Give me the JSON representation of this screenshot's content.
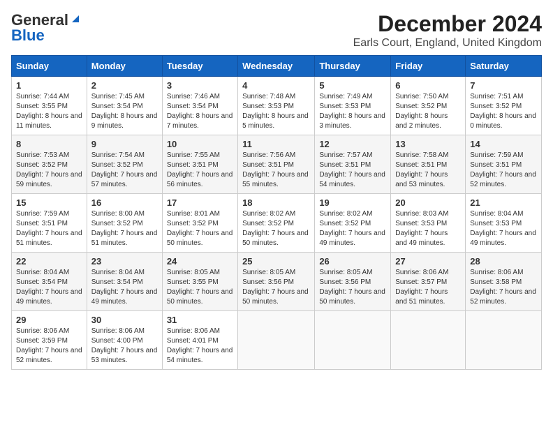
{
  "logo": {
    "general": "General",
    "blue": "Blue"
  },
  "title": "December 2024",
  "subtitle": "Earls Court, England, United Kingdom",
  "days_of_week": [
    "Sunday",
    "Monday",
    "Tuesday",
    "Wednesday",
    "Thursday",
    "Friday",
    "Saturday"
  ],
  "weeks": [
    [
      {
        "day": "1",
        "sunrise": "7:44 AM",
        "sunset": "3:55 PM",
        "daylight": "8 hours and 11 minutes."
      },
      {
        "day": "2",
        "sunrise": "7:45 AM",
        "sunset": "3:54 PM",
        "daylight": "8 hours and 9 minutes."
      },
      {
        "day": "3",
        "sunrise": "7:46 AM",
        "sunset": "3:54 PM",
        "daylight": "8 hours and 7 minutes."
      },
      {
        "day": "4",
        "sunrise": "7:48 AM",
        "sunset": "3:53 PM",
        "daylight": "8 hours and 5 minutes."
      },
      {
        "day": "5",
        "sunrise": "7:49 AM",
        "sunset": "3:53 PM",
        "daylight": "8 hours and 3 minutes."
      },
      {
        "day": "6",
        "sunrise": "7:50 AM",
        "sunset": "3:52 PM",
        "daylight": "8 hours and 2 minutes."
      },
      {
        "day": "7",
        "sunrise": "7:51 AM",
        "sunset": "3:52 PM",
        "daylight": "8 hours and 0 minutes."
      }
    ],
    [
      {
        "day": "8",
        "sunrise": "7:53 AM",
        "sunset": "3:52 PM",
        "daylight": "7 hours and 59 minutes."
      },
      {
        "day": "9",
        "sunrise": "7:54 AM",
        "sunset": "3:52 PM",
        "daylight": "7 hours and 57 minutes."
      },
      {
        "day": "10",
        "sunrise": "7:55 AM",
        "sunset": "3:51 PM",
        "daylight": "7 hours and 56 minutes."
      },
      {
        "day": "11",
        "sunrise": "7:56 AM",
        "sunset": "3:51 PM",
        "daylight": "7 hours and 55 minutes."
      },
      {
        "day": "12",
        "sunrise": "7:57 AM",
        "sunset": "3:51 PM",
        "daylight": "7 hours and 54 minutes."
      },
      {
        "day": "13",
        "sunrise": "7:58 AM",
        "sunset": "3:51 PM",
        "daylight": "7 hours and 53 minutes."
      },
      {
        "day": "14",
        "sunrise": "7:59 AM",
        "sunset": "3:51 PM",
        "daylight": "7 hours and 52 minutes."
      }
    ],
    [
      {
        "day": "15",
        "sunrise": "7:59 AM",
        "sunset": "3:51 PM",
        "daylight": "7 hours and 51 minutes."
      },
      {
        "day": "16",
        "sunrise": "8:00 AM",
        "sunset": "3:52 PM",
        "daylight": "7 hours and 51 minutes."
      },
      {
        "day": "17",
        "sunrise": "8:01 AM",
        "sunset": "3:52 PM",
        "daylight": "7 hours and 50 minutes."
      },
      {
        "day": "18",
        "sunrise": "8:02 AM",
        "sunset": "3:52 PM",
        "daylight": "7 hours and 50 minutes."
      },
      {
        "day": "19",
        "sunrise": "8:02 AM",
        "sunset": "3:52 PM",
        "daylight": "7 hours and 49 minutes."
      },
      {
        "day": "20",
        "sunrise": "8:03 AM",
        "sunset": "3:53 PM",
        "daylight": "7 hours and 49 minutes."
      },
      {
        "day": "21",
        "sunrise": "8:04 AM",
        "sunset": "3:53 PM",
        "daylight": "7 hours and 49 minutes."
      }
    ],
    [
      {
        "day": "22",
        "sunrise": "8:04 AM",
        "sunset": "3:54 PM",
        "daylight": "7 hours and 49 minutes."
      },
      {
        "day": "23",
        "sunrise": "8:04 AM",
        "sunset": "3:54 PM",
        "daylight": "7 hours and 49 minutes."
      },
      {
        "day": "24",
        "sunrise": "8:05 AM",
        "sunset": "3:55 PM",
        "daylight": "7 hours and 50 minutes."
      },
      {
        "day": "25",
        "sunrise": "8:05 AM",
        "sunset": "3:56 PM",
        "daylight": "7 hours and 50 minutes."
      },
      {
        "day": "26",
        "sunrise": "8:05 AM",
        "sunset": "3:56 PM",
        "daylight": "7 hours and 50 minutes."
      },
      {
        "day": "27",
        "sunrise": "8:06 AM",
        "sunset": "3:57 PM",
        "daylight": "7 hours and 51 minutes."
      },
      {
        "day": "28",
        "sunrise": "8:06 AM",
        "sunset": "3:58 PM",
        "daylight": "7 hours and 52 minutes."
      }
    ],
    [
      {
        "day": "29",
        "sunrise": "8:06 AM",
        "sunset": "3:59 PM",
        "daylight": "7 hours and 52 minutes."
      },
      {
        "day": "30",
        "sunrise": "8:06 AM",
        "sunset": "4:00 PM",
        "daylight": "7 hours and 53 minutes."
      },
      {
        "day": "31",
        "sunrise": "8:06 AM",
        "sunset": "4:01 PM",
        "daylight": "7 hours and 54 minutes."
      },
      null,
      null,
      null,
      null
    ]
  ]
}
